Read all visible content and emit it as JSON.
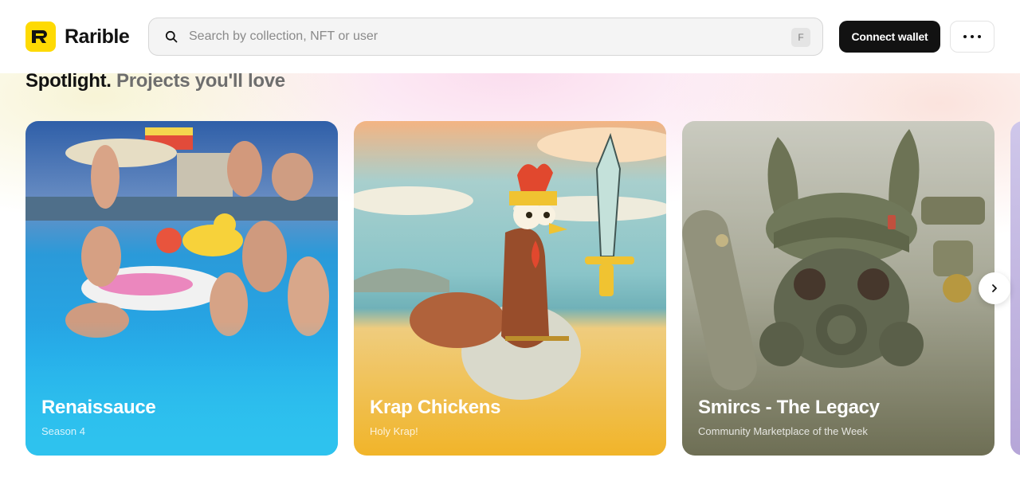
{
  "header": {
    "brand": "Rarible",
    "search": {
      "placeholder": "Search by collection, NFT or user",
      "shortcut": "F"
    },
    "connect_label": "Connect wallet"
  },
  "spotlight": {
    "title": "Spotlight.",
    "subtitle": "Projects you'll love",
    "cards": [
      {
        "title": "Renaissauce",
        "subtitle": "Season 4"
      },
      {
        "title": "Krap Chickens",
        "subtitle": "Holy Krap!"
      },
      {
        "title": "Smircs - The Legacy",
        "subtitle": "Community Marketplace of the Week"
      }
    ]
  },
  "icons": {
    "logo": "rarible-logo-icon",
    "search": "search-icon",
    "more": "more-icon",
    "next": "chevron-right-icon"
  },
  "colors": {
    "brand_yellow": "#FEDA03",
    "connect_button": "#121212",
    "card1_bottom": "#2EC2EE",
    "card2_bottom": "#F2B52A",
    "card3_bottom": "#6E6F55"
  }
}
